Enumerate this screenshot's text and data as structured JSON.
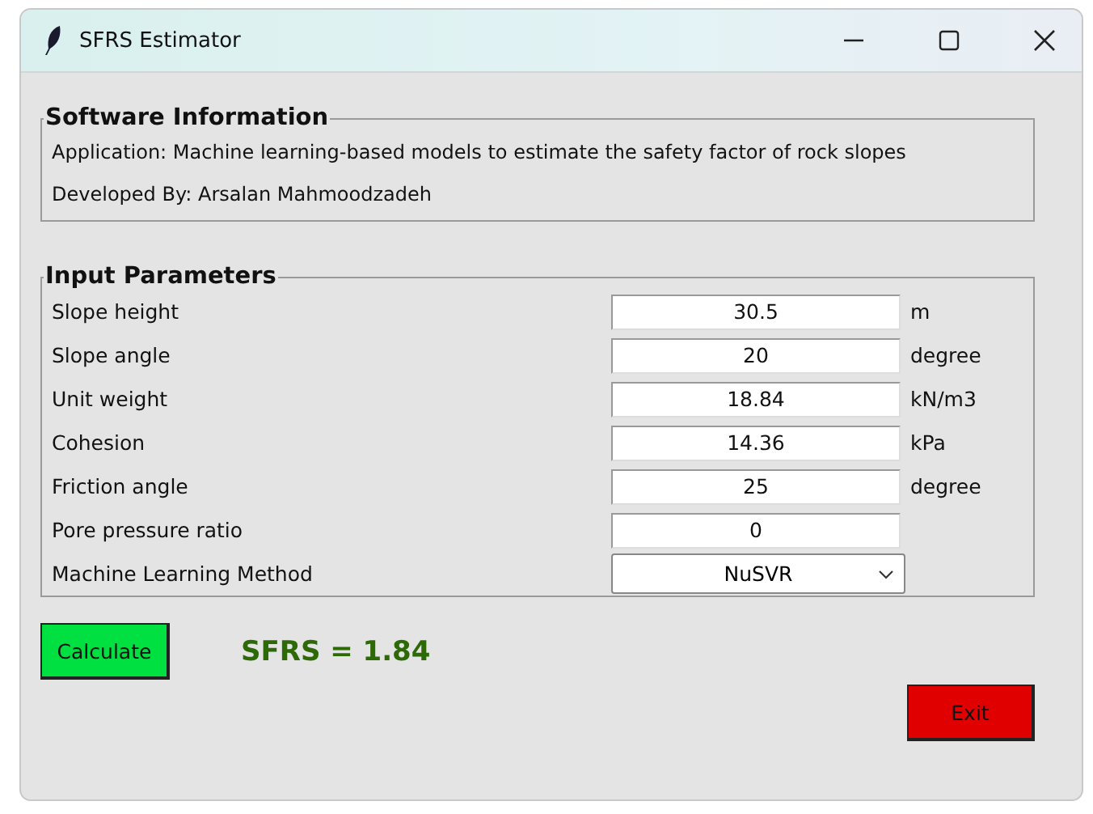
{
  "window": {
    "title": "SFRS Estimator"
  },
  "software_information": {
    "title": "Software Information",
    "lines": [
      "Application: Machine learning-based models to estimate the safety factor of rock slopes",
      "Developed By: Arsalan Mahmoodzadeh"
    ]
  },
  "input_parameters": {
    "title": "Input Parameters",
    "rows": [
      {
        "kind": "entry",
        "label": "Slope height",
        "value": "30.5",
        "unit": "m"
      },
      {
        "kind": "entry",
        "label": "Slope angle",
        "value": "20",
        "unit": "degree"
      },
      {
        "kind": "entry",
        "label": "Unit weight",
        "value": "18.84",
        "unit": "kN/m3"
      },
      {
        "kind": "entry",
        "label": "Cohesion",
        "value": "14.36",
        "unit": "kPa"
      },
      {
        "kind": "entry",
        "label": "Friction angle",
        "value": "25",
        "unit": "degree"
      },
      {
        "kind": "entry",
        "label": "Pore pressure ratio",
        "value": "0"
      },
      {
        "kind": "dropdown",
        "label": "Machine Learning Method",
        "value": "NuSVR"
      }
    ]
  },
  "calculate_button": "Calculate",
  "result": "SFRS = 1.84",
  "exit_button": "Exit"
}
